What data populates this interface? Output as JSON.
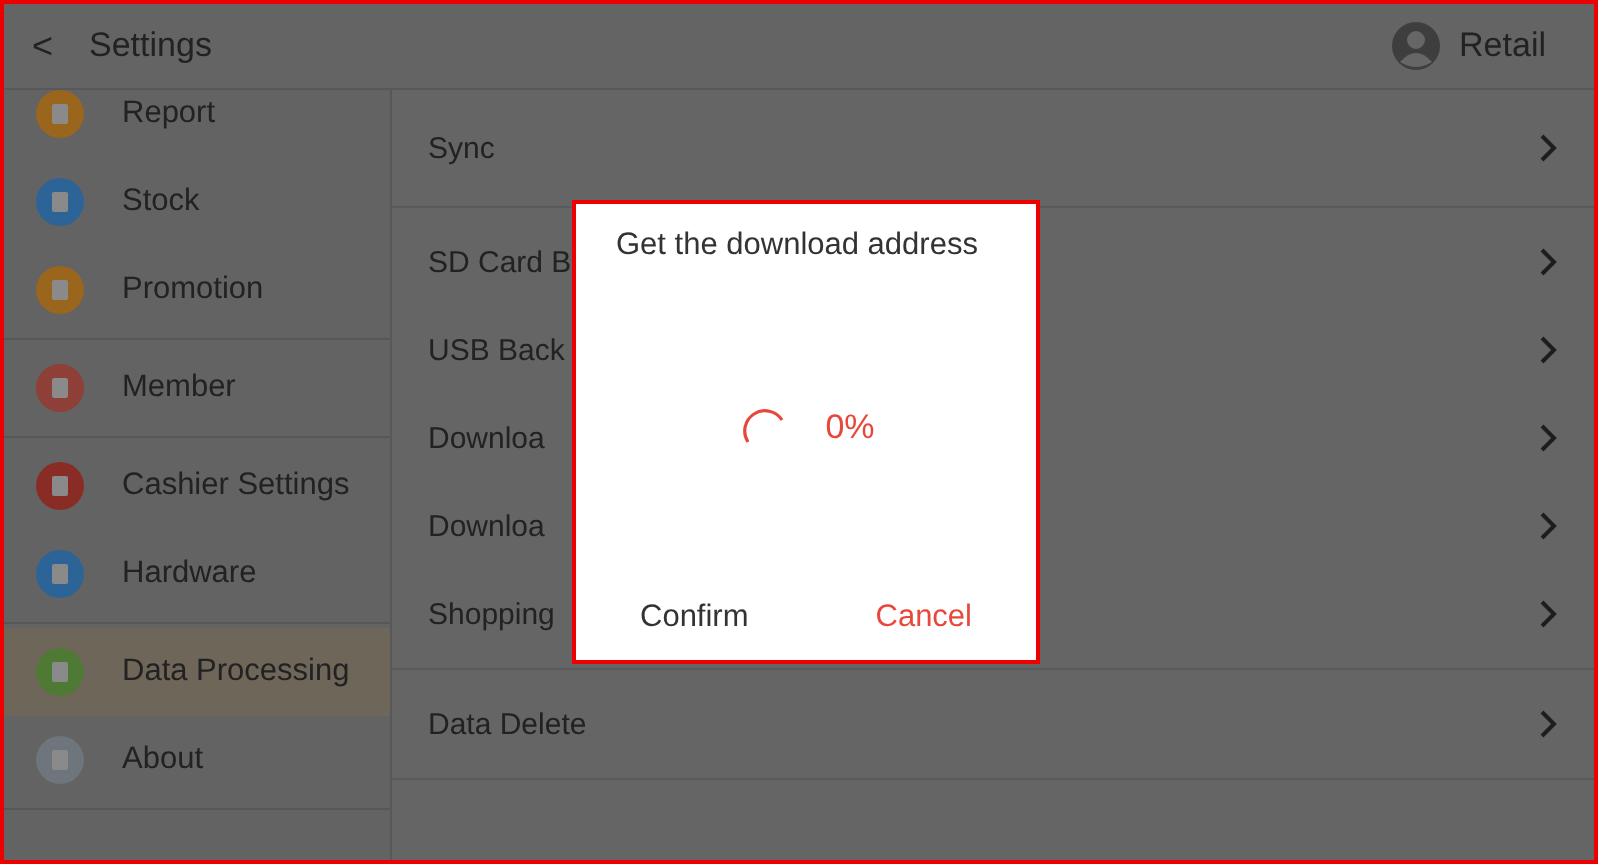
{
  "header": {
    "back": "<",
    "title": "Settings",
    "user": "Retail"
  },
  "sidebar": {
    "groups": [
      {
        "items": [
          {
            "label": "Report",
            "color": "#9a661e",
            "selected": false
          },
          {
            "label": "Stock",
            "color": "#2d6497",
            "selected": false
          },
          {
            "label": "Promotion",
            "color": "#9a661e",
            "selected": false
          }
        ]
      },
      {
        "items": [
          {
            "label": "Member",
            "color": "#8e3f38",
            "selected": false
          }
        ]
      },
      {
        "items": [
          {
            "label": "Cashier Settings",
            "color": "#8a2c26",
            "selected": false
          },
          {
            "label": "Hardware",
            "color": "#2d6497",
            "selected": false
          }
        ]
      },
      {
        "items": [
          {
            "label": "Data Processing",
            "color": "#4e7a35",
            "selected": true
          },
          {
            "label": "About",
            "color": "#6e757d",
            "selected": false
          }
        ]
      }
    ]
  },
  "list": {
    "groups": [
      {
        "items": [
          {
            "label": "Sync"
          }
        ]
      },
      {
        "items": [
          {
            "label": "SD Card B"
          },
          {
            "label": "USB Back"
          },
          {
            "label": "Downloa"
          },
          {
            "label": "Downloa"
          },
          {
            "label": "Shopping"
          }
        ]
      },
      {
        "items": [
          {
            "label": "Data Delete"
          }
        ]
      }
    ]
  },
  "dialog": {
    "title": "Get the download address",
    "progress": "0%",
    "buttons": [
      {
        "label": "Confirm",
        "kind": "neutral"
      },
      {
        "label": "Cancel",
        "kind": "danger"
      }
    ]
  }
}
